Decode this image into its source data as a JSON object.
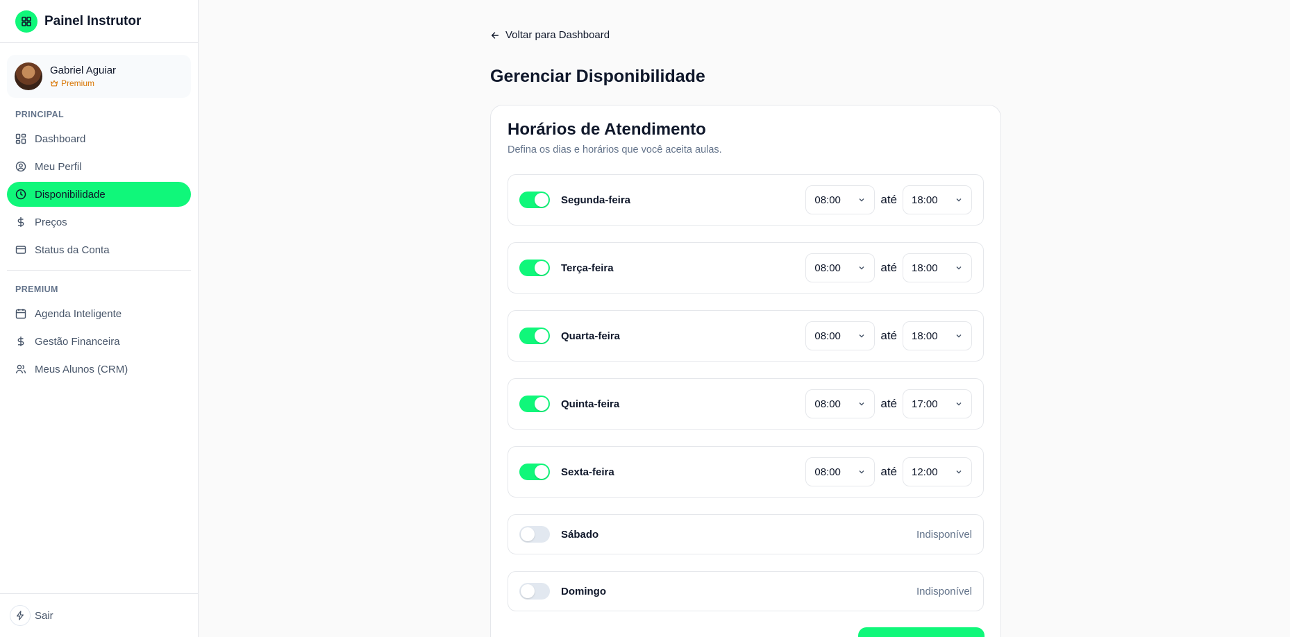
{
  "colors": {
    "accent": "#10f77a",
    "premium": "#d97706",
    "muted_text": "#64748b",
    "border": "#e5e7eb"
  },
  "sidebar": {
    "brand": {
      "title": "Painel Instrutor",
      "icon": "grid-logo-icon"
    },
    "profile": {
      "name": "Gabriel Aguiar",
      "badge": "Premium",
      "badge_icon": "crown-icon"
    },
    "sections": [
      {
        "label": "PRINCIPAL",
        "items": [
          {
            "label": "Dashboard",
            "icon": "dashboard-icon",
            "active": false
          },
          {
            "label": "Meu Perfil",
            "icon": "user-circle-icon",
            "active": false
          },
          {
            "label": "Disponibilidade",
            "icon": "clock-icon",
            "active": true
          },
          {
            "label": "Preços",
            "icon": "dollar-icon",
            "active": false
          },
          {
            "label": "Status da Conta",
            "icon": "credit-card-icon",
            "active": false
          }
        ]
      },
      {
        "label": "PREMIUM",
        "items": [
          {
            "label": "Agenda Inteligente",
            "icon": "calendar-icon",
            "active": false
          },
          {
            "label": "Gestão Financeira",
            "icon": "dollar-icon",
            "active": false
          },
          {
            "label": "Meus Alunos (CRM)",
            "icon": "users-icon",
            "active": false
          }
        ]
      }
    ],
    "footer": {
      "label": "Sair",
      "icon": "lightning-icon"
    }
  },
  "main": {
    "back_link": "Voltar para Dashboard",
    "page_title": "Gerenciar Disponibilidade",
    "card": {
      "title": "Horários de Atendimento",
      "subtitle": "Defina os dias e horários que você aceita aulas.",
      "until_label": "até",
      "unavailable_label": "Indisponível",
      "days": [
        {
          "name": "Segunda-feira",
          "enabled": true,
          "start": "08:00",
          "end": "18:00"
        },
        {
          "name": "Terça-feira",
          "enabled": true,
          "start": "08:00",
          "end": "18:00"
        },
        {
          "name": "Quarta-feira",
          "enabled": true,
          "start": "08:00",
          "end": "18:00"
        },
        {
          "name": "Quinta-feira",
          "enabled": true,
          "start": "08:00",
          "end": "17:00"
        },
        {
          "name": "Sexta-feira",
          "enabled": true,
          "start": "08:00",
          "end": "12:00"
        },
        {
          "name": "Sábado",
          "enabled": false
        },
        {
          "name": "Domingo",
          "enabled": false
        }
      ]
    }
  }
}
